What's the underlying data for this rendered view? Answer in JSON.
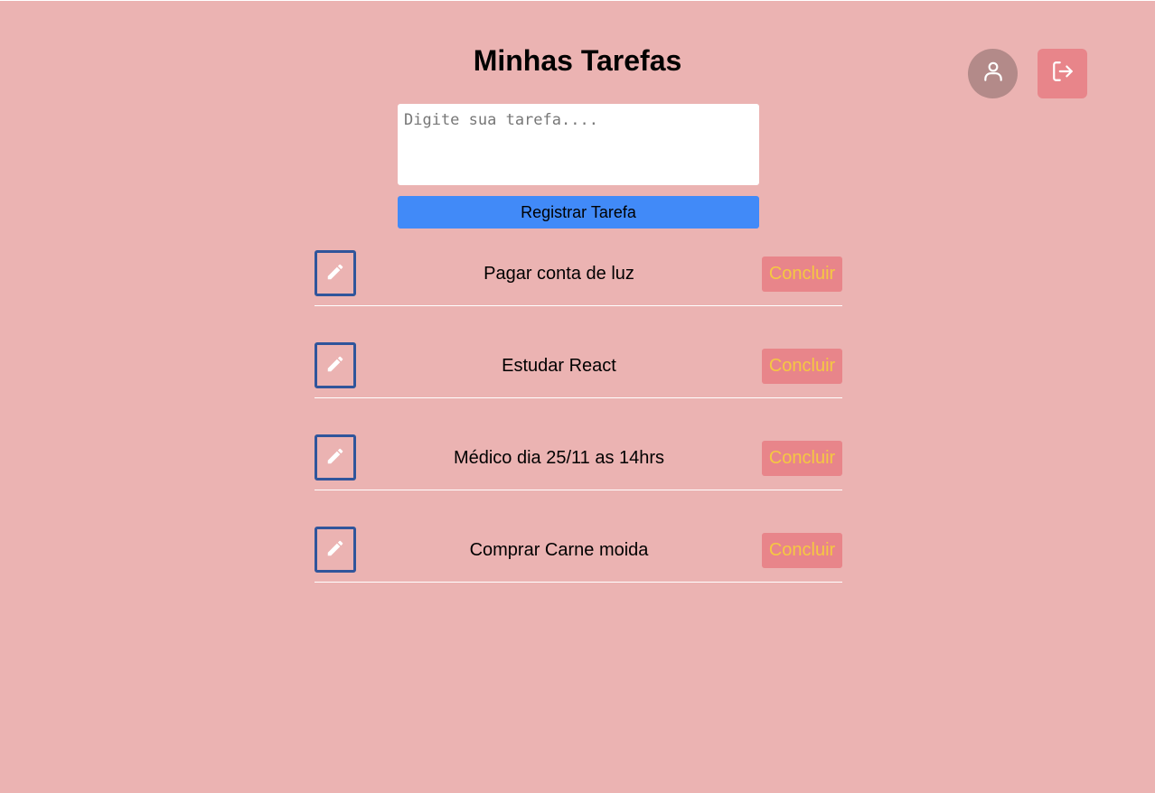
{
  "header": {
    "title": "Minhas Tarefas",
    "profile_icon": "user-icon",
    "logout_icon": "logout-icon"
  },
  "form": {
    "input_placeholder": "Digite sua tarefa....",
    "input_value": "",
    "register_label": "Registrar Tarefa"
  },
  "tasks": [
    {
      "text": "Pagar conta de luz",
      "action_label": "Concluir"
    },
    {
      "text": "Estudar React",
      "action_label": "Concluir"
    },
    {
      "text": "Médico dia 25/11 as 14hrs",
      "action_label": "Concluir"
    },
    {
      "text": "Comprar Carne moida",
      "action_label": "Concluir"
    }
  ],
  "colors": {
    "background": "#ebb3b2",
    "register_button": "#418af8",
    "conclude_button": "#e8858a",
    "conclude_text": "#f5c842",
    "edit_border": "#30559b",
    "profile_button": "#b38a89"
  }
}
